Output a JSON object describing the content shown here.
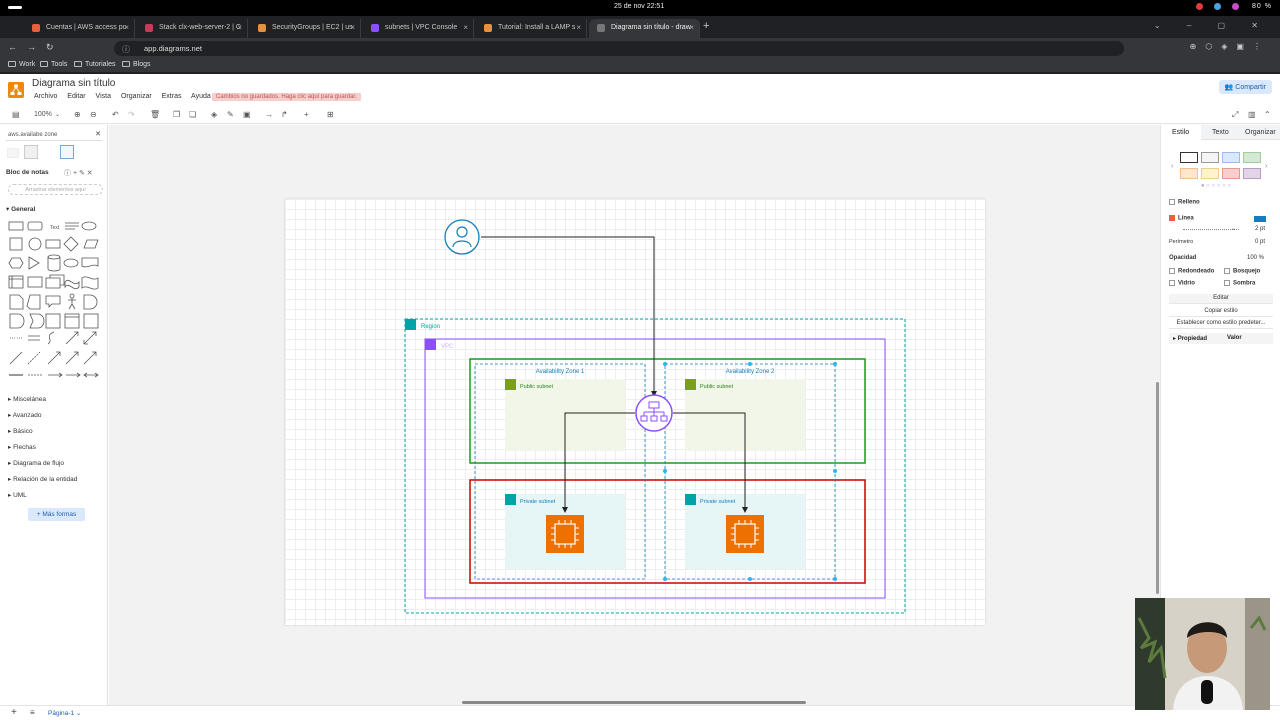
{
  "os": {
    "clock": "25 de nov  22:51",
    "battery": "80 %"
  },
  "browser": {
    "tabs": [
      {
        "label": "Cuentas | AWS access po",
        "favcolor": "#e8613c"
      },
      {
        "label": "Stack clx-web-server-2 | C",
        "favcolor": "#c83a5a"
      },
      {
        "label": "SecurityGroups | EC2 | us",
        "favcolor": "#e8913c"
      },
      {
        "label": "subnets | VPC Console",
        "favcolor": "#8c4fff"
      },
      {
        "label": "Tutorial: Install a LAMP s",
        "favcolor": "#e8913c"
      },
      {
        "label": "Diagrama sin título - draw",
        "favcolor": "#777777"
      }
    ],
    "url_host": "app.diagrams.net",
    "bookmarks": [
      "Work",
      "Tools",
      "Tutoriales",
      "Blogs"
    ]
  },
  "app": {
    "title": "Diagrama sin título",
    "menus": [
      "Archivo",
      "Editar",
      "Vista",
      "Organizar",
      "Extras",
      "Ayuda"
    ],
    "unsaved_notice": "Cambios no guardados. Haga clic aquí para guardar.",
    "share_label": "Compartir",
    "zoom": "100%",
    "search_value": "aws.availabe zone",
    "scratchpad_label": "Bloc de notas",
    "dropzone_text": "Arrastrar elementos aquí",
    "general_label": "General",
    "categories": [
      "Miscelánea",
      "Avanzado",
      "Básico",
      "Flechas",
      "Diagrama de flujo",
      "Relación de la entidad",
      "UML"
    ],
    "more_shapes": "+ Más formas",
    "page_label": "Página-1"
  },
  "diagram": {
    "region_label": "Region",
    "vpc_label": "VPC",
    "az1_label": "Availability Zone 1",
    "az2_label": "Availability Zone 2",
    "public_subnet_label": "Public subnet",
    "private_subnet_label": "Private subnet",
    "colors": {
      "region": "#00a4a6",
      "vpc": "#8c4fff",
      "public_border": "#1a9c1a",
      "private_border": "#cc0000",
      "public_fill": "#f2f6e9",
      "private_fill": "#e6f6f7",
      "ec2": "#ed7100",
      "user": "#147eba",
      "alb": "#8c4fff"
    }
  },
  "format_panel": {
    "tabs": [
      "Estilo",
      "Texto",
      "Organizar"
    ],
    "fill_label": "Relleno",
    "line_label": "Línea",
    "line_width": "2 pt",
    "perimeter_label": "Perímetro",
    "perimeter_value": "0 pt",
    "opacity_label": "Opacidad",
    "opacity_value": "100 %",
    "rounded_label": "Redondeado",
    "sketch_label": "Bosquejo",
    "glass_label": "Vidrio",
    "shadow_label": "Sombra",
    "edit_label": "Editar",
    "copy_style_label": "Copiar estilo",
    "default_style_label": "Establecer como estilo predeter...",
    "property_label": "Propiedad",
    "value_label": "Valor",
    "swatches": [
      "#ffffff",
      "#f5f5f5",
      "#dae8fc",
      "#d5e8d4",
      "#ffe6cc",
      "#fff2cc",
      "#f8cecc",
      "#e1d5e7"
    ]
  }
}
